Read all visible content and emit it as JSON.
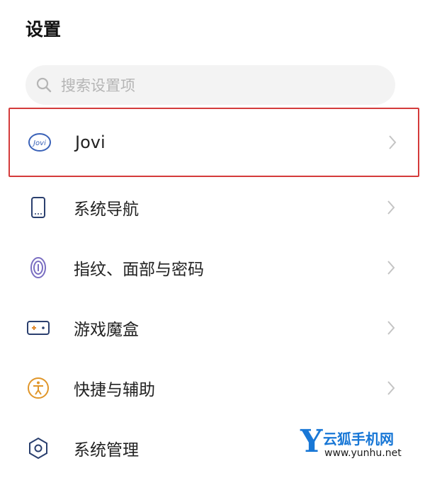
{
  "header": {
    "title": "设置"
  },
  "search": {
    "placeholder": "搜索设置项"
  },
  "items": [
    {
      "label": "Jovi",
      "icon": "jovi-icon",
      "highlighted": true
    },
    {
      "label": "系统导航",
      "icon": "phone-icon"
    },
    {
      "label": "指纹、面部与密码",
      "icon": "fingerprint-icon"
    },
    {
      "label": "游戏魔盒",
      "icon": "game-box-icon"
    },
    {
      "label": "快捷与辅助",
      "icon": "accessibility-icon"
    },
    {
      "label": "系统管理",
      "icon": "hexagon-icon"
    }
  ],
  "watermark": {
    "logo": "Y",
    "name": "云狐手机网",
    "url": "www.yunhu.net"
  },
  "colors": {
    "highlight_border": "#d43b3b",
    "search_bg": "#f3f3f3",
    "watermark": "#1877d6"
  }
}
